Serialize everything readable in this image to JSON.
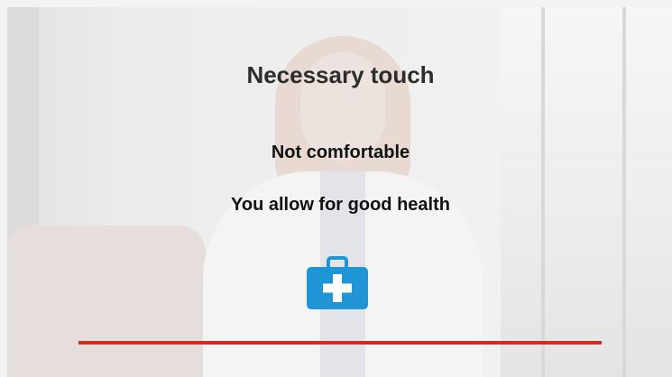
{
  "slide": {
    "title": "Necessary touch",
    "lines": [
      "Not comfortable",
      "You allow for good health"
    ],
    "icon": "first-aid-kit-icon"
  },
  "colors": {
    "title": "#2d2d2d",
    "text": "#111111",
    "kit": "#1f95d6",
    "divider": "#cf2d1f"
  }
}
